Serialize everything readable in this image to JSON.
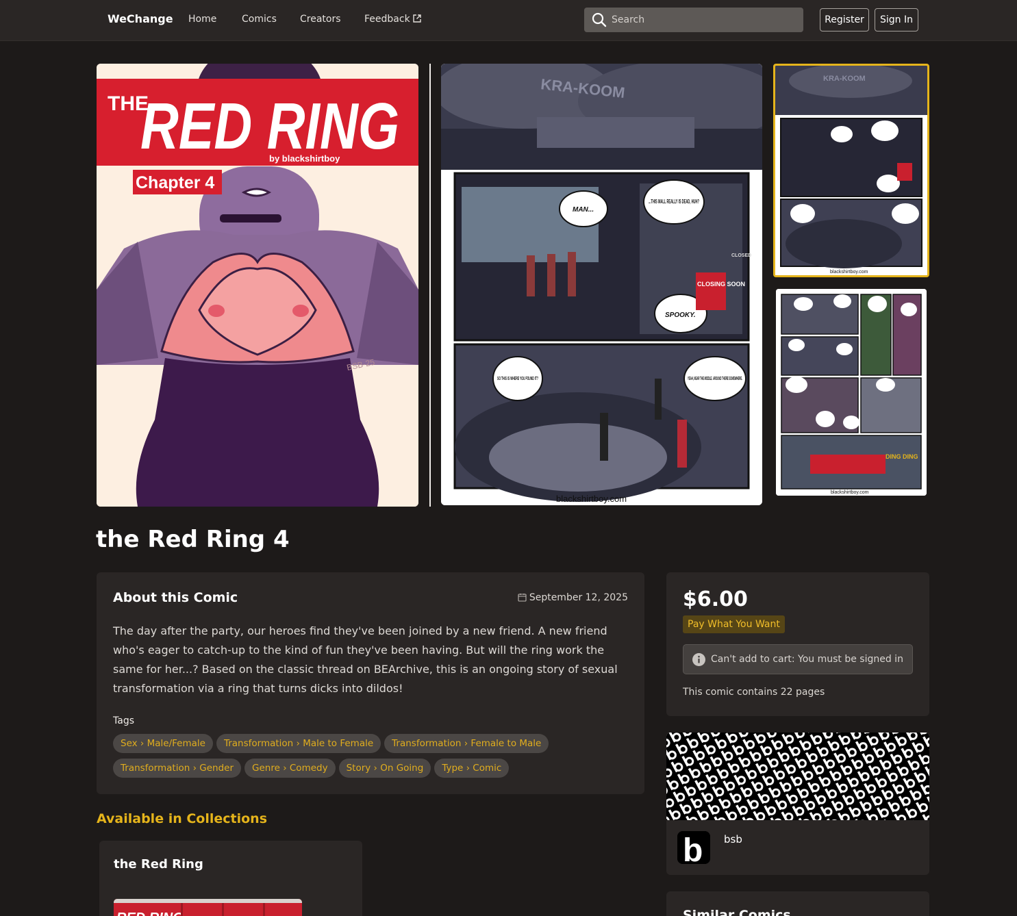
{
  "nav": {
    "brand": "WeChange",
    "links": [
      "Home",
      "Comics",
      "Creators",
      "Feedback"
    ],
    "search_placeholder": "Search",
    "register": "Register",
    "sign_in": "Sign In"
  },
  "cover": {
    "the": "THE",
    "title": "RED RING",
    "byline": "by blackshirtboy",
    "chapter": "Chapter 4",
    "signature": "BSB-25"
  },
  "page_preview": {
    "sfx": "KRA-KOOM",
    "bubble_1": "MAN...",
    "bubble_2": "...THIS MALL REALLY IS DEAD, HUH?",
    "bubble_3": "SPOOKY.",
    "bubble_4": "SO THIS IS WHERE YOU FOUND IT?",
    "bubble_5": "YEAH, NEAR THE MIDDLE. AROUND THERE SOMEWHERE.",
    "sign_closed": "CLOSED",
    "sign_closing": "CLOSING SOON",
    "url": "blackshirtboy.com"
  },
  "thumb_2": {
    "sfx": "DING DING",
    "url": "blackshirtboy.com"
  },
  "comic": {
    "title": "the Red Ring 4",
    "about_heading": "About this Comic",
    "date": "September 12, 2025",
    "description": "The day after the party, our heroes find they've been joined by a new friend. A new friend who's eager to catch-up to the kind of fun they've been having. But will the ring work the same for her...? Based on the classic thread on BEArchive, this is an ongoing story of sexual transformation via a ring that turns dicks into dildos!",
    "tags_label": "Tags",
    "tags": [
      "Sex › Male/Female",
      "Transformation › Male to Female",
      "Transformation › Female to Male",
      "Transformation › Gender",
      "Genre › Comedy",
      "Story › On Going",
      "Type › Comic"
    ]
  },
  "purchase": {
    "price": "$6.00",
    "badge": "Pay What You Want",
    "cart_notice": "Can't add to cart: You must be signed in",
    "pages_note": "This comic contains 22 pages"
  },
  "creator": {
    "name": "bsb",
    "avatar_letter": "b"
  },
  "collections": {
    "heading": "Available in Collections",
    "items": [
      {
        "title": "the Red Ring"
      }
    ]
  },
  "similar": {
    "heading": "Similar Comics"
  },
  "colors": {
    "accent": "#e5b41b",
    "background": "#1d1a19",
    "card": "#2a2625"
  }
}
